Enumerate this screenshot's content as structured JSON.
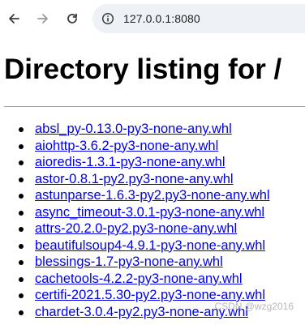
{
  "browser": {
    "url": "127.0.0.1:8080",
    "icons": {
      "back": "back-arrow-icon",
      "forward": "forward-arrow-icon",
      "reload": "reload-icon",
      "info": "site-info-icon"
    }
  },
  "page": {
    "title": "Directory listing for /",
    "files": [
      "absl_py-0.13.0-py3-none-any.whl",
      "aiohttp-3.6.2-py3-none-any.whl",
      "aioredis-1.3.1-py3-none-any.whl",
      "astor-0.8.1-py2.py3-none-any.whl",
      "astunparse-1.6.3-py2.py3-none-any.whl",
      "async_timeout-3.0.1-py3-none-any.whl",
      "attrs-20.2.0-py2.py3-none-any.whl",
      "beautifulsoup4-4.9.1-py3-none-any.whl",
      "blessings-1.7-py3-none-any.whl",
      "cachetools-4.2.2-py3-none-any.whl",
      "certifi-2021.5.30-py2.py3-none-any.whl",
      "chardet-3.0.4-py2.py3-none-any.whl"
    ]
  },
  "watermark": "CSDN @wzg2016",
  "colors": {
    "link": "#0000ee",
    "omnibox_bg": "#eef1f6",
    "rule": "#9a9a9a"
  }
}
